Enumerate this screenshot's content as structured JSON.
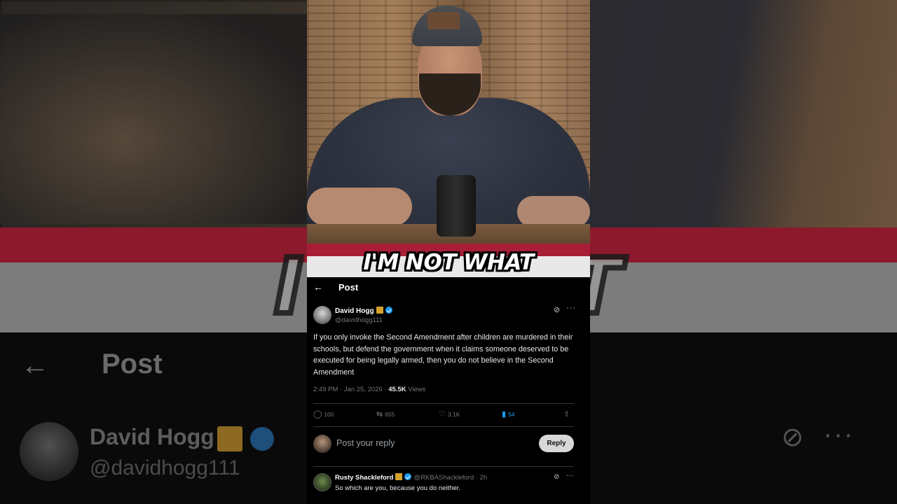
{
  "background": {
    "caption": "I'M NOT WHAT",
    "back_arrow": "←",
    "header_title": "Post",
    "author_name": "David Hogg",
    "author_handle": "@davidhogg111",
    "more_icon": "···"
  },
  "video": {
    "caption": "I'M NOT WHAT"
  },
  "tweet": {
    "header": {
      "back_icon": "←",
      "title": "Post"
    },
    "author": {
      "name": "David Hogg",
      "handle": "@davidhogg111"
    },
    "body": "If you only invoke the Second Amendment after children are murdered in their schools, but defend the government when it claims someone deserved to be executed for being legally armed, then you do not believe in the Second Amendment",
    "timestamp": "2:49 PM · Jan 25, 2026 · ",
    "views_count": "45.5K",
    "views_label": " Views",
    "actions": {
      "replies": "100",
      "reposts": "655",
      "likes": "3.1K",
      "bookmarks": "54"
    },
    "reply_placeholder": "Post your reply",
    "reply_button": "Reply",
    "comment": {
      "name": "Rusty Shackleford",
      "handle": "@RKBAShackleford · 2h",
      "text": "So which are you, because you do neither."
    }
  },
  "colors": {
    "accent": "#1d9bf0",
    "caption_band": "#a81e36",
    "badge_gold": "#d6a12b"
  }
}
